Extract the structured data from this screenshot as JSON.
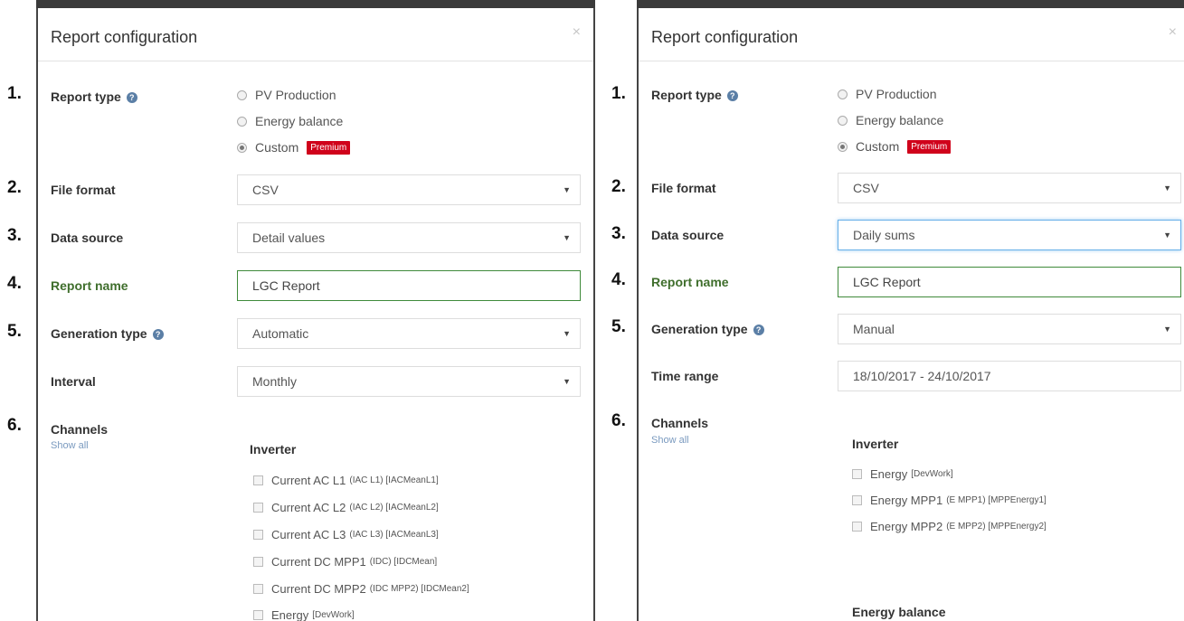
{
  "left": {
    "title": "Report configuration",
    "close": "×",
    "numbers": [
      "1.",
      "2.",
      "3.",
      "4.",
      "5.",
      "6."
    ],
    "report_type": {
      "label": "Report type",
      "options": [
        "PV Production",
        "Energy balance",
        "Custom"
      ],
      "selected": 2,
      "badge": "Premium"
    },
    "file_format": {
      "label": "File format",
      "value": "CSV"
    },
    "data_source": {
      "label": "Data source",
      "value": "Detail values"
    },
    "report_name": {
      "label": "Report name",
      "value": "LGC Report"
    },
    "generation_type": {
      "label": "Generation type",
      "value": "Automatic"
    },
    "interval": {
      "label": "Interval",
      "value": "Monthly"
    },
    "channels": {
      "label": "Channels",
      "show_all": "Show all",
      "section": "Inverter",
      "items": [
        {
          "name": "Current AC L1",
          "detail": "(IAC L1) [IACMeanL1]"
        },
        {
          "name": "Current AC L2",
          "detail": "(IAC L2) [IACMeanL2]"
        },
        {
          "name": "Current AC L3",
          "detail": "(IAC L3) [IACMeanL3]"
        },
        {
          "name": "Current DC MPP1",
          "detail": "(IDC) [IDCMean]"
        },
        {
          "name": "Current DC MPP2",
          "detail": "(IDC MPP2) [IDCMean2]"
        },
        {
          "name": "Energy",
          "detail": "[DevWork]"
        }
      ]
    }
  },
  "right": {
    "title": "Report configuration",
    "close": "×",
    "numbers": [
      "1.",
      "2.",
      "3.",
      "4.",
      "5.",
      "6."
    ],
    "report_type": {
      "label": "Report type",
      "options": [
        "PV Production",
        "Energy balance",
        "Custom"
      ],
      "selected": 2,
      "badge": "Premium"
    },
    "file_format": {
      "label": "File format",
      "value": "CSV"
    },
    "data_source": {
      "label": "Data source",
      "value": "Daily sums"
    },
    "report_name": {
      "label": "Report name",
      "value": "LGC Report"
    },
    "generation_type": {
      "label": "Generation type",
      "value": "Manual"
    },
    "time_range": {
      "label": "Time range",
      "value": "18/10/2017 - 24/10/2017"
    },
    "channels": {
      "label": "Channels",
      "show_all": "Show all",
      "section": "Inverter",
      "items": [
        {
          "name": "Energy",
          "detail": "[DevWork]"
        },
        {
          "name": "Energy MPP1",
          "detail": "(E MPP1) [MPPEnergy1]"
        },
        {
          "name": "Energy MPP2",
          "detail": "(E MPP2) [MPPEnergy2]"
        }
      ],
      "section2": "Energy balance"
    }
  },
  "icons": {
    "info": "info-circle-icon",
    "caret": "caret-down-icon",
    "close": "close-icon"
  },
  "colors": {
    "premium_badge": "#d0021b",
    "valid_border": "#3f8a3a",
    "report_name_label": "#3f6e2c",
    "focus_border": "#66afe9"
  }
}
